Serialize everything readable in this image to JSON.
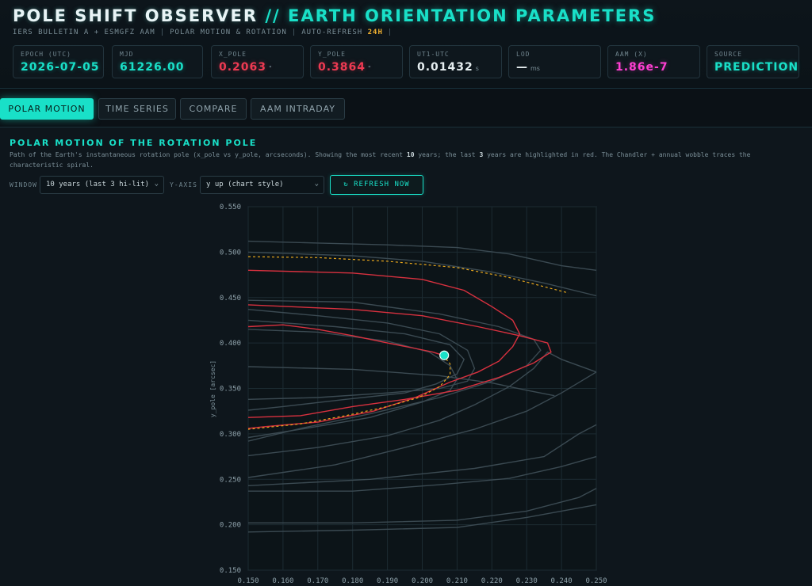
{
  "header": {
    "title_main": "POLE SHIFT OBSERVER",
    "title_sep": "//",
    "title_sub": "EARTH ORIENTATION PARAMETERS",
    "sub_source": "IERS BULLETIN A + ESMGFZ AAM",
    "sub_mode": "POLAR MOTION & ROTATION",
    "sub_refresh_label": "AUTO-REFRESH",
    "sub_refresh_value": "24H"
  },
  "stats": [
    {
      "label": "EPOCH (UTC)",
      "value": "2026-07-05",
      "unit": "",
      "color": "#19e0c8"
    },
    {
      "label": "MJD",
      "value": "61226.00",
      "unit": "",
      "color": "#19e0c8"
    },
    {
      "label": "X_POLE",
      "value": "0.2063",
      "unit": "\"",
      "color": "#ee3a52"
    },
    {
      "label": "Y_POLE",
      "value": "0.3864",
      "unit": "\"",
      "color": "#ee3a52"
    },
    {
      "label": "UT1-UTC",
      "value": "0.01432",
      "unit": "s",
      "color": "#e6eef0"
    },
    {
      "label": "LOD",
      "value": "—",
      "unit": "ms",
      "color": "#e6eef0"
    },
    {
      "label": "AAM (X)",
      "value": "1.86e-7",
      "unit": "",
      "color": "#ff3fd2"
    },
    {
      "label": "SOURCE",
      "value": "PREDICTION",
      "unit": "",
      "color": "#19e0c8"
    }
  ],
  "tabs": [
    "POLAR MOTION",
    "TIME SERIES",
    "COMPARE",
    "AAM INTRADAY"
  ],
  "panel": {
    "title": "POLAR MOTION OF THE ROTATION POLE",
    "desc_a": "Path of the Earth's instantaneous rotation pole (x_pole vs y_pole, arcseconds). Showing the most recent ",
    "desc_b": "10",
    "desc_c": " years; the last ",
    "desc_d": "3",
    "desc_e": " years are highlighted in red. The Chandler + annual wobble traces the characteristic spiral.",
    "window_label": "WINDOW",
    "window_value": "10 years (last 3 hi-lit)",
    "yaxis_label": "Y-AXIS",
    "yaxis_value": "y up (chart style)",
    "refresh_label": "↻ REFRESH NOW"
  },
  "chart_data": {
    "type": "line",
    "title": "",
    "xlabel": "",
    "ylabel": "y_pole [arcsec]",
    "xlim": [
      0.15,
      0.25
    ],
    "ylim": [
      0.15,
      0.55
    ],
    "x_ticks": [
      "0.150",
      "0.160",
      "0.170",
      "0.180",
      "0.190",
      "0.200",
      "0.210",
      "0.220",
      "0.230",
      "0.240",
      "0.250"
    ],
    "y_ticks": [
      "0.550",
      "0.500",
      "0.450",
      "0.400",
      "0.350",
      "0.300",
      "0.250",
      "0.200",
      "0.150"
    ],
    "grid": true,
    "series_style": {
      "history": "#3b4a52",
      "recent": "#d8313f",
      "prediction": "#e8a71c",
      "current": "#19e0c8"
    },
    "history": [
      [
        [
          0.15,
          0.512
        ],
        [
          0.17,
          0.51
        ],
        [
          0.19,
          0.508
        ],
        [
          0.21,
          0.505
        ],
        [
          0.225,
          0.498
        ],
        [
          0.24,
          0.485
        ],
        [
          0.25,
          0.48
        ]
      ],
      [
        [
          0.15,
          0.5
        ],
        [
          0.18,
          0.496
        ],
        [
          0.2,
          0.49
        ],
        [
          0.22,
          0.478
        ],
        [
          0.235,
          0.466
        ],
        [
          0.25,
          0.452
        ]
      ],
      [
        [
          0.15,
          0.437
        ],
        [
          0.17,
          0.43
        ],
        [
          0.19,
          0.422
        ],
        [
          0.205,
          0.41
        ],
        [
          0.213,
          0.392
        ],
        [
          0.215,
          0.372
        ],
        [
          0.213,
          0.358
        ],
        [
          0.205,
          0.35
        ],
        [
          0.19,
          0.345
        ],
        [
          0.17,
          0.34
        ],
        [
          0.15,
          0.338
        ]
      ],
      [
        [
          0.15,
          0.425
        ],
        [
          0.175,
          0.418
        ],
        [
          0.195,
          0.41
        ],
        [
          0.208,
          0.398
        ],
        [
          0.212,
          0.382
        ],
        [
          0.21,
          0.366
        ],
        [
          0.204,
          0.355
        ],
        [
          0.195,
          0.345
        ],
        [
          0.178,
          0.338
        ],
        [
          0.16,
          0.33
        ],
        [
          0.15,
          0.326
        ]
      ],
      [
        [
          0.15,
          0.447
        ],
        [
          0.18,
          0.445
        ],
        [
          0.205,
          0.432
        ],
        [
          0.222,
          0.418
        ],
        [
          0.232,
          0.404
        ],
        [
          0.234,
          0.392
        ],
        [
          0.23,
          0.375
        ],
        [
          0.22,
          0.358
        ],
        [
          0.205,
          0.34
        ],
        [
          0.185,
          0.322
        ],
        [
          0.165,
          0.306
        ],
        [
          0.15,
          0.292
        ]
      ],
      [
        [
          0.15,
          0.415
        ],
        [
          0.17,
          0.412
        ],
        [
          0.19,
          0.402
        ],
        [
          0.202,
          0.39
        ],
        [
          0.208,
          0.375
        ],
        [
          0.21,
          0.36
        ],
        [
          0.208,
          0.348
        ],
        [
          0.2,
          0.335
        ],
        [
          0.185,
          0.318
        ],
        [
          0.165,
          0.305
        ],
        [
          0.15,
          0.296
        ]
      ],
      [
        [
          0.15,
          0.276
        ],
        [
          0.17,
          0.285
        ],
        [
          0.19,
          0.298
        ],
        [
          0.205,
          0.315
        ],
        [
          0.215,
          0.332
        ],
        [
          0.225,
          0.352
        ],
        [
          0.232,
          0.372
        ],
        [
          0.236,
          0.39
        ],
        [
          0.24,
          0.382
        ],
        [
          0.25,
          0.368
        ]
      ],
      [
        [
          0.15,
          0.252
        ],
        [
          0.175,
          0.266
        ],
        [
          0.195,
          0.285
        ],
        [
          0.215,
          0.305
        ],
        [
          0.23,
          0.325
        ],
        [
          0.24,
          0.345
        ],
        [
          0.25,
          0.368
        ]
      ],
      [
        [
          0.15,
          0.243
        ],
        [
          0.185,
          0.25
        ],
        [
          0.215,
          0.262
        ],
        [
          0.235,
          0.275
        ],
        [
          0.245,
          0.3
        ],
        [
          0.25,
          0.31
        ]
      ],
      [
        [
          0.15,
          0.202
        ],
        [
          0.18,
          0.202
        ],
        [
          0.21,
          0.205
        ],
        [
          0.23,
          0.215
        ],
        [
          0.245,
          0.23
        ],
        [
          0.25,
          0.24
        ]
      ],
      [
        [
          0.15,
          0.192
        ],
        [
          0.18,
          0.194
        ],
        [
          0.21,
          0.197
        ],
        [
          0.23,
          0.208
        ],
        [
          0.25,
          0.222
        ]
      ],
      [
        [
          0.15,
          0.237
        ],
        [
          0.18,
          0.237
        ],
        [
          0.205,
          0.244
        ],
        [
          0.225,
          0.251
        ],
        [
          0.24,
          0.264
        ],
        [
          0.25,
          0.275
        ]
      ],
      [
        [
          0.15,
          0.374
        ],
        [
          0.18,
          0.371
        ],
        [
          0.205,
          0.364
        ],
        [
          0.22,
          0.356
        ],
        [
          0.23,
          0.348
        ],
        [
          0.238,
          0.342
        ]
      ]
    ],
    "recent": [
      [
        [
          0.15,
          0.48
        ],
        [
          0.18,
          0.477
        ],
        [
          0.2,
          0.47
        ],
        [
          0.212,
          0.458
        ],
        [
          0.22,
          0.44
        ],
        [
          0.226,
          0.425
        ],
        [
          0.228,
          0.41
        ],
        [
          0.226,
          0.396
        ],
        [
          0.222,
          0.38
        ],
        [
          0.216,
          0.368
        ],
        [
          0.208,
          0.357
        ],
        [
          0.198,
          0.34
        ],
        [
          0.186,
          0.325
        ],
        [
          0.17,
          0.313
        ],
        [
          0.155,
          0.308
        ],
        [
          0.15,
          0.306
        ]
      ],
      [
        [
          0.15,
          0.442
        ],
        [
          0.18,
          0.437
        ],
        [
          0.2,
          0.43
        ],
        [
          0.216,
          0.418
        ],
        [
          0.228,
          0.408
        ],
        [
          0.236,
          0.4
        ],
        [
          0.237,
          0.39
        ],
        [
          0.232,
          0.378
        ],
        [
          0.222,
          0.362
        ],
        [
          0.21,
          0.348
        ],
        [
          0.195,
          0.338
        ],
        [
          0.18,
          0.33
        ],
        [
          0.165,
          0.32
        ],
        [
          0.15,
          0.318
        ]
      ],
      [
        [
          0.15,
          0.418
        ],
        [
          0.16,
          0.42
        ],
        [
          0.17,
          0.415
        ],
        [
          0.18,
          0.408
        ],
        [
          0.19,
          0.4
        ],
        [
          0.198,
          0.394
        ],
        [
          0.203,
          0.39
        ],
        [
          0.206,
          0.3864
        ]
      ]
    ],
    "prediction": [
      [
        [
          0.15,
          0.495
        ],
        [
          0.17,
          0.494
        ],
        [
          0.19,
          0.49
        ],
        [
          0.21,
          0.483
        ],
        [
          0.225,
          0.472
        ],
        [
          0.237,
          0.46
        ],
        [
          0.242,
          0.455
        ]
      ],
      [
        [
          0.206,
          0.3864
        ],
        [
          0.208,
          0.377
        ],
        [
          0.208,
          0.365
        ],
        [
          0.205,
          0.352
        ],
        [
          0.199,
          0.34
        ],
        [
          0.19,
          0.33
        ],
        [
          0.178,
          0.32
        ],
        [
          0.165,
          0.311
        ],
        [
          0.15,
          0.305
        ]
      ]
    ],
    "current": {
      "x": 0.2063,
      "y": 0.3864
    }
  }
}
